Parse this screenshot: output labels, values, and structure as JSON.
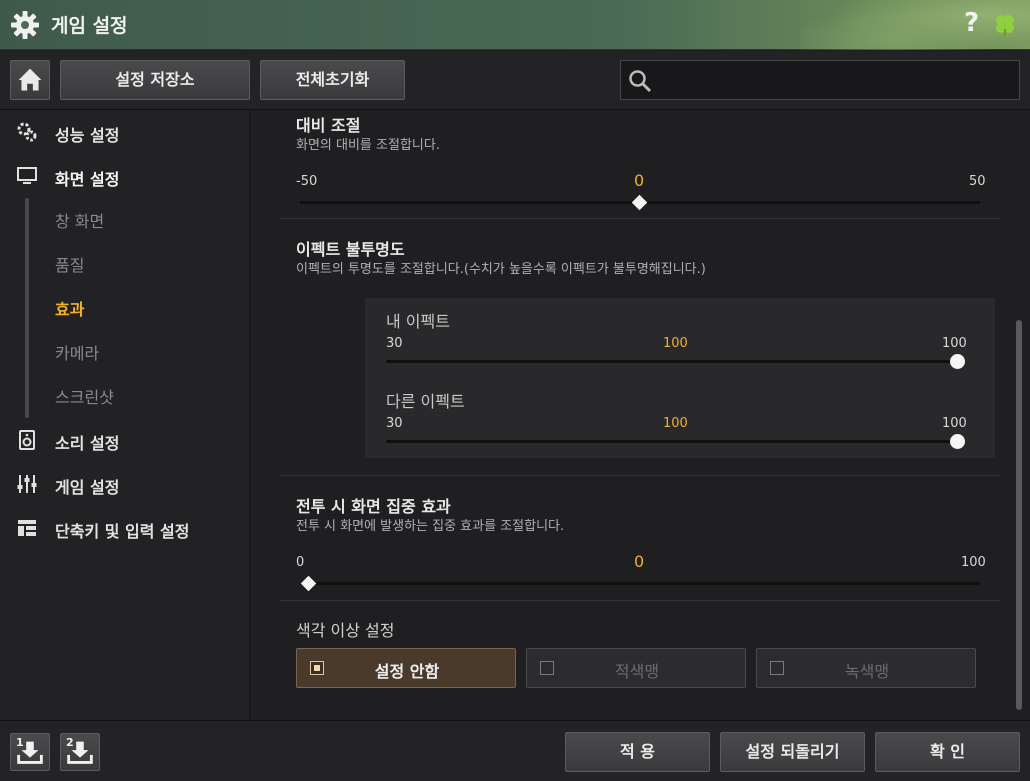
{
  "window": {
    "title": "게임 설정",
    "help_label": "?",
    "accent": "#f0b030"
  },
  "toolbar": {
    "store_label": "설정 저장소",
    "reset_label": "전체초기화",
    "search_placeholder": ""
  },
  "sidebar": {
    "items": [
      {
        "label": "성능 설정",
        "icon": "gears-icon"
      },
      {
        "label": "화면 설정",
        "icon": "monitor-icon"
      },
      {
        "label": "소리 설정",
        "icon": "speaker-icon"
      },
      {
        "label": "게임 설정",
        "icon": "sliders-icon"
      },
      {
        "label": "단축키 및 입력 설정",
        "icon": "layout-icon"
      }
    ],
    "sub_items": [
      {
        "label": "창 화면"
      },
      {
        "label": "품질"
      },
      {
        "label": "효과"
      },
      {
        "label": "카메라"
      },
      {
        "label": "스크린샷"
      }
    ],
    "current_sub": "효과"
  },
  "contrast": {
    "title": "대비 조절",
    "desc": "화면의 대비를 조절합니다.",
    "min": "-50",
    "max": "50",
    "value": "0",
    "value_num": 0,
    "min_num": -50,
    "max_num": 50
  },
  "effect_opacity": {
    "title": "이펙트 불투명도",
    "desc": "이펙트의 투명도를 조절합니다.(수치가 높을수록 이펙트가 불투명해집니다.)",
    "mine": {
      "label": "내 이펙트",
      "min": "30",
      "max": "100",
      "value": "100"
    },
    "others": {
      "label": "다른 이펙트",
      "min": "30",
      "max": "100",
      "value": "100"
    }
  },
  "combat_focus": {
    "title": "전투 시 화면 집중 효과",
    "desc": "전투 시 화면에 발생하는 집중 효과를 조절합니다.",
    "min": "0",
    "max": "100",
    "value": "0"
  },
  "color_blind": {
    "title": "색각 이상 설정",
    "options": [
      {
        "label": "설정 안함",
        "selected": true
      },
      {
        "label": "적색맹",
        "selected": false
      },
      {
        "label": "녹색맹",
        "selected": false
      }
    ]
  },
  "footer": {
    "slot1": "1",
    "slot2": "2",
    "apply_label": "적 용",
    "revert_label": "설정 되돌리기",
    "ok_label": "확 인"
  }
}
